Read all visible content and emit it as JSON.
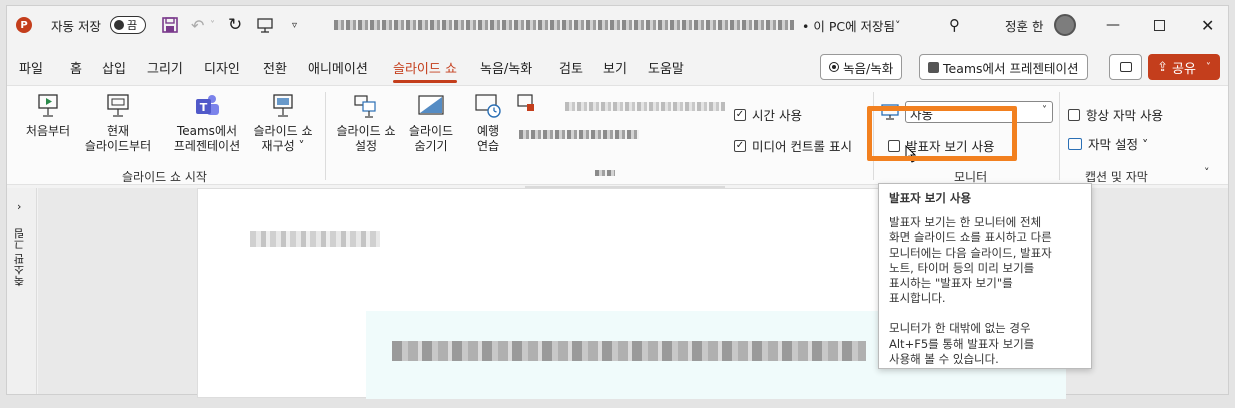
{
  "titlebar": {
    "app_letter": "P",
    "autosave_label": "자동 저장",
    "autosave_state": "끔",
    "save_status": "• 이 PC에 저장됨",
    "user_name": "정훈 한"
  },
  "menu": {
    "items": [
      "파일",
      "홈",
      "삽입",
      "그리기",
      "디자인",
      "전환",
      "애니메이션",
      "슬라이드 쇼",
      "녹음/녹화",
      "검토",
      "보기",
      "도움말"
    ],
    "active": "슬라이드 쇼"
  },
  "actions": {
    "record_label": "녹음/녹화",
    "teams_label": "Teams에서 프레젠테이션",
    "share_label": "공유"
  },
  "ribbon": {
    "start_group": {
      "buttons": [
        "처음부터",
        "현재\n슬라이드부터",
        "Teams에서\n프레젠테이션",
        "슬라이드 쇼\n재구성 ˅"
      ],
      "label": "슬라이드 쇼 시작"
    },
    "setup_group": {
      "buttons": [
        "슬라이드 쇼\n설정",
        "슬라이드\n숨기기",
        "예행\n연습"
      ]
    },
    "checks": {
      "use_timings": "시간 사용",
      "show_media_controls": "미디어 컨트롤 표시"
    },
    "monitor_group": {
      "monitor_value": "자동",
      "presenter_view": "발표자 보기 사용",
      "label": "모니터"
    },
    "captions_group": {
      "always_subtitles": "항상 자막 사용",
      "subtitle_settings": "자막 설정 ˅",
      "label": "캡션 및 자막"
    }
  },
  "thumbnail_pane_label": "축소판 그림",
  "tooltip": {
    "title": "발표자 보기 사용",
    "body1": "발표자 보기는 한 모니터에 전체\n화면 슬라이드 쇼를 표시하고 다른\n모니터에는 다음 슬라이드, 발표자\n노트, 타이머 등의 미리 보기를\n표시하는 \"발표자 보기\"를\n표시합니다.",
    "body2": "모니터가 한 대밖에 없는 경우\nAlt+F5를 통해 발표자 보기를\n사용해 볼 수 있습니다."
  },
  "colors": {
    "accent": "#c43e1c",
    "highlight": "#f2801f"
  }
}
